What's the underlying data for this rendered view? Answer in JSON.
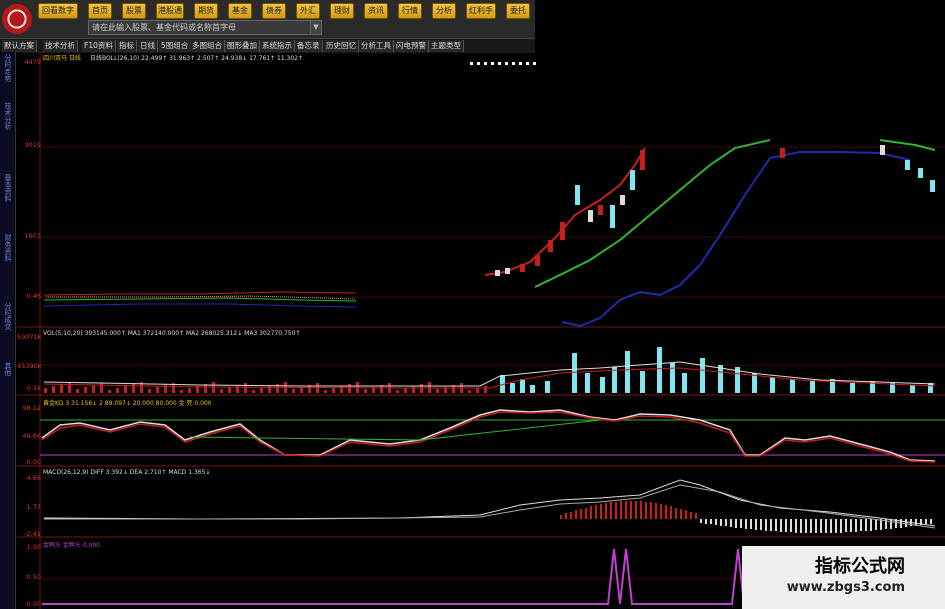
{
  "toolbar": {
    "buttons": [
      "回看数字",
      "首页",
      "股票",
      "港股通",
      "期货",
      "基金",
      "债券",
      "外汇",
      "理财",
      "资讯",
      "行情",
      "分析",
      "红利手",
      "委托"
    ],
    "search_placeholder": "请在此输入股票、基金代码或名称首字母",
    "dropdown_glyph": "▼"
  },
  "menubar": {
    "items": [
      "默认方案",
      "技术分析",
      "F10资料",
      "指标",
      "日线",
      "5图组合",
      "多图组合",
      "图形叠加",
      "系统指示",
      "备忘录",
      "历史回忆",
      "分析工具",
      "闪电预警",
      "主题类型"
    ]
  },
  "side_tabs": [
    "分时走势",
    "技术分析",
    "基本资料",
    "财务资料",
    "分时成交",
    "其他"
  ],
  "main_chart": {
    "stock_name": "四川双马 日线",
    "indicator_line": "日线BOLL(26,10) 22.499↑ 31.963↑ 2.507↑ 24.938↓ 17.761↑ 11.302↑",
    "axis_labels": [
      "4479",
      "3019",
      "1603",
      "0.46"
    ]
  },
  "vol_panel": {
    "label": "VOL(5,10,20) 393145.000↑ MA1 372140.000↑ MA2 268025.312↓ MA3 302770.750↑",
    "axis_labels": [
      "59071k",
      "45390k",
      "0.1k"
    ]
  },
  "kdj_panel": {
    "label": "黄金KD 3 31.156↓ 2 89.097↓ 20.000 80.000 金 死 0.000",
    "axis_labels": [
      "98.12",
      "49.66",
      "0.00"
    ]
  },
  "macd_panel": {
    "label": "MACD(26,12,9) DIFF 3.392↓ DEA 2.710↑ MACD 1.365↓",
    "axis_labels": [
      "4.66",
      "1.77",
      "-2.41"
    ]
  },
  "signal_panel": {
    "label": "金鸭头 金鸭头 0.000",
    "axis_labels": [
      "1.00",
      "0.50",
      "0.00"
    ]
  },
  "watermark": {
    "title": "指标公式网",
    "url": "www.zbgs3.com"
  },
  "colors": {
    "toolbar_button": "#e2b12e",
    "upper_band": "#c81e1e",
    "middle_band": "#2eb82e",
    "lower_band": "#1d2db0",
    "volume_bar": "#7fe6f0",
    "signal_line": "#c040d0"
  }
}
